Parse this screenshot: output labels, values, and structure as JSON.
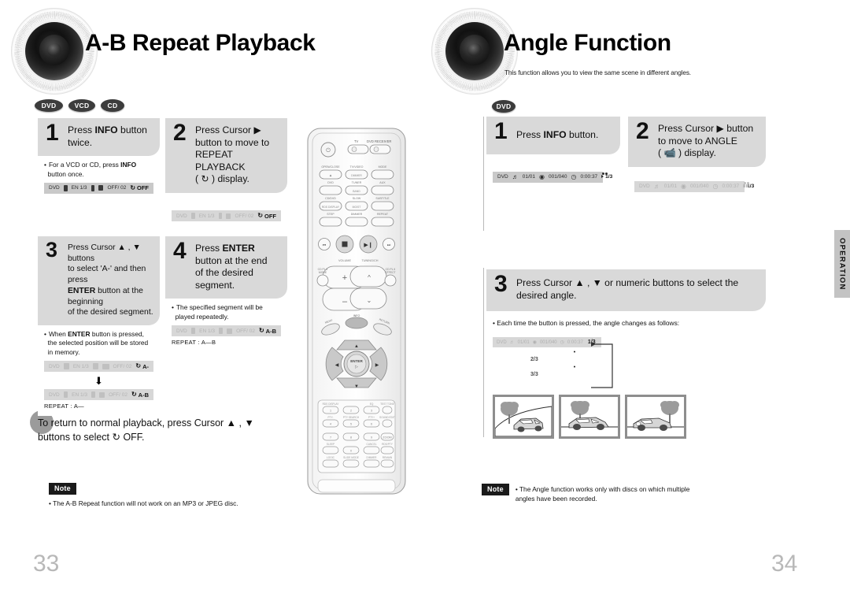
{
  "document": {
    "type": "dvd-player-manual-spread",
    "side_tab_label": "OPERATION"
  },
  "left_page": {
    "page_number": "33",
    "title": "A-B Repeat Playback",
    "disc_badges": [
      "DVD",
      "VCD",
      "CD"
    ],
    "steps": [
      {
        "number": "1",
        "text_parts": [
          {
            "t": "Press ",
            "b": false
          },
          {
            "t": "INFO",
            "b": true
          },
          {
            "t": " button twice.",
            "b": false
          }
        ],
        "bullet_parts": [
          {
            "t": "For a VCD or CD, press ",
            "b": false
          },
          {
            "t": "INFO",
            "b": true
          },
          {
            "t": " button once.",
            "b": false
          }
        ],
        "osd": {
          "dim": false,
          "label": "DVD",
          "audio": "EN 1/3",
          "subtitle": "OFF/ 02",
          "repeat": "OFF"
        }
      },
      {
        "number": "2",
        "text_parts": [
          {
            "t": "Press Cursor ▶ button to move to REPEAT PLAYBACK ( ↺ ) display.",
            "b": false
          }
        ],
        "bullet_parts": [],
        "osd": {
          "dim": true,
          "label": "DVD",
          "audio": "EN 1/3",
          "subtitle": "OFF/ 02",
          "repeat": "OFF"
        }
      },
      {
        "number": "3",
        "text_parts": [
          {
            "t": "Press Cursor ▲ , ▼ buttons to select 'A-' and then press ",
            "b": false
          },
          {
            "t": "ENTER",
            "b": true
          },
          {
            "t": " button at the beginning of the desired segment.",
            "b": false
          }
        ],
        "bullet_parts": [
          {
            "t": "When ",
            "b": false
          },
          {
            "t": "ENTER",
            "b": true
          },
          {
            "t": " button is pressed, the selected position will be stored in memory.",
            "b": false
          }
        ],
        "osd": {
          "dim": true,
          "label": "DVD",
          "audio": "EN 1/3",
          "subtitle": "OFF/ 02",
          "repeat": "A-"
        },
        "osd2": {
          "dim": true,
          "label": "DVD",
          "audio": "EN 1/3",
          "subtitle": "OFF/ 02",
          "repeat": "A-B"
        },
        "repeat_line": "REPEAT : A—",
        "arrow": "⬇"
      },
      {
        "number": "4",
        "text_parts": [
          {
            "t": "Press ",
            "b": false
          },
          {
            "t": "ENTER",
            "b": true
          },
          {
            "t": " button at the end of the desired segment.",
            "b": false
          }
        ],
        "bullet_parts": [
          {
            "t": "The specified segment will be played repeatedly.",
            "b": false
          }
        ],
        "osd": {
          "dim": true,
          "label": "DVD",
          "audio": "EN 1/3",
          "subtitle": "OFF/ 02",
          "repeat": "A-B"
        },
        "repeat_line": "REPEAT : A—B"
      }
    ],
    "summary": "To return to normal playback, press Cursor ▲ , ▼ buttons to select ↺ OFF.",
    "note": {
      "badge": "Note",
      "text": "• The A-B Repeat function will not work on an MP3 or JPEG disc."
    }
  },
  "right_page": {
    "page_number": "34",
    "title": "Angle Function",
    "subtitle": "This function allows you to view the same scene in different angles.",
    "disc_badges": [
      "DVD"
    ],
    "steps": [
      {
        "number": "1",
        "text_parts": [
          {
            "t": "Press ",
            "b": false
          },
          {
            "t": "INFO",
            "b": true
          },
          {
            "t": " button.",
            "b": false
          }
        ],
        "osd": {
          "dim": false,
          "label": "DVD",
          "title_no": "01/01",
          "chapter_no": "001/040",
          "time": "0:00:37",
          "angle": "1/3"
        }
      },
      {
        "number": "2",
        "text_parts": [
          {
            "t": "Press Cursor ▶ button to move to ANGLE ( 📹 ) display.",
            "b": false
          }
        ],
        "osd": {
          "dim": true,
          "label": "DVD",
          "title_no": "01/01",
          "chapter_no": "001/040",
          "time": "0:00:37",
          "angle": "1/3"
        }
      },
      {
        "number": "3",
        "text_parts": [
          {
            "t": "Press Cursor ▲ , ▼ or numeric buttons to select the desired angle.",
            "b": false
          }
        ],
        "bullet": "• Each time the button is pressed, the angle changes as follows:",
        "cycle_osd": {
          "dim": true,
          "label": "DVD",
          "title_no": "01/01",
          "chapter_no": "001/040",
          "time": "0:00:37",
          "angle": "1/3"
        },
        "cycle_angles": [
          "2/3",
          "3/3"
        ]
      }
    ],
    "angle_images_caption": "",
    "note": {
      "badge": "Note",
      "text": "• The Angle function works only with discs on which multiple angles have been recorded."
    }
  },
  "remote": {
    "power_label": "⏻",
    "source_labels": [
      "TV",
      "DVD RECEIVER"
    ],
    "button_rows": [
      [
        "OPEN/CLOSE",
        "TV/VIDEO",
        "MODE"
      ],
      [
        "DVD",
        "TUNER",
        "AUX"
      ],
      [
        "CD/DVD",
        "SLOW",
        "SUBTITLE"
      ],
      [
        "STEP",
        "DIMMER",
        "REPEAT"
      ]
    ],
    "transport": [
      "⏮",
      "■",
      "▶❙❙",
      "⏭"
    ],
    "volume_label": "VOLUME",
    "tuning_label": "TUNING/CH",
    "left_small": "CD PL II MODE",
    "right_small": "CD PL II EFFECT",
    "center_label": "ENTER",
    "numeric": [
      "1",
      "2",
      "3",
      "4",
      "5",
      "6",
      "7",
      "8",
      "9",
      "0"
    ],
    "bottom_rows": [
      [
        "SLEEP",
        "CANCEL",
        "RDS/PTY"
      ],
      [
        "LOGIC",
        "SLIDE MODE",
        "DIMMER",
        "REMAIN"
      ]
    ]
  },
  "colors": {
    "step_box": "#d9d9d9",
    "osd_bar": "#c9c9c9",
    "osd_bar_dim": "#d7d7d7",
    "note_badge": "#1a1a1a",
    "page_number": "#b8b8b8",
    "side_tab": "#c3c3c3",
    "blob": "#9b9b9b"
  }
}
